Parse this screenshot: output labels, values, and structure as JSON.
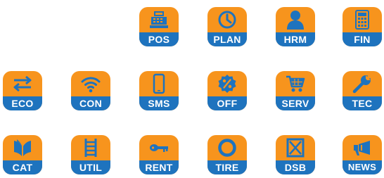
{
  "colors": {
    "tile_top": "#F7941D",
    "tile_label_bg": "#1E73BE",
    "icon": "#1E73BE",
    "label_text": "#FFFFFF"
  },
  "apps": [
    {
      "label": "POS",
      "icon": "cash-register-icon"
    },
    {
      "label": "PLAN",
      "icon": "clock-icon"
    },
    {
      "label": "HRM",
      "icon": "person-icon"
    },
    {
      "label": "FIN",
      "icon": "calculator-icon"
    },
    {
      "label": "ECO",
      "icon": "exchange-arrows-icon"
    },
    {
      "label": "CON",
      "icon": "wifi-icon"
    },
    {
      "label": "SMS",
      "icon": "smartphone-icon"
    },
    {
      "label": "OFF",
      "icon": "percent-badge-icon"
    },
    {
      "label": "SERV",
      "icon": "shopping-cart-icon"
    },
    {
      "label": "TEC",
      "icon": "wrench-icon"
    },
    {
      "label": "CAT",
      "icon": "open-book-icon"
    },
    {
      "label": "UTIL",
      "icon": "ladder-icon"
    },
    {
      "label": "RENT",
      "icon": "key-icon"
    },
    {
      "label": "TIRE",
      "icon": "tire-icon"
    },
    {
      "label": "DSB",
      "icon": "crossed-box-icon"
    },
    {
      "label": "NEWS",
      "icon": "megaphone-icon"
    }
  ]
}
